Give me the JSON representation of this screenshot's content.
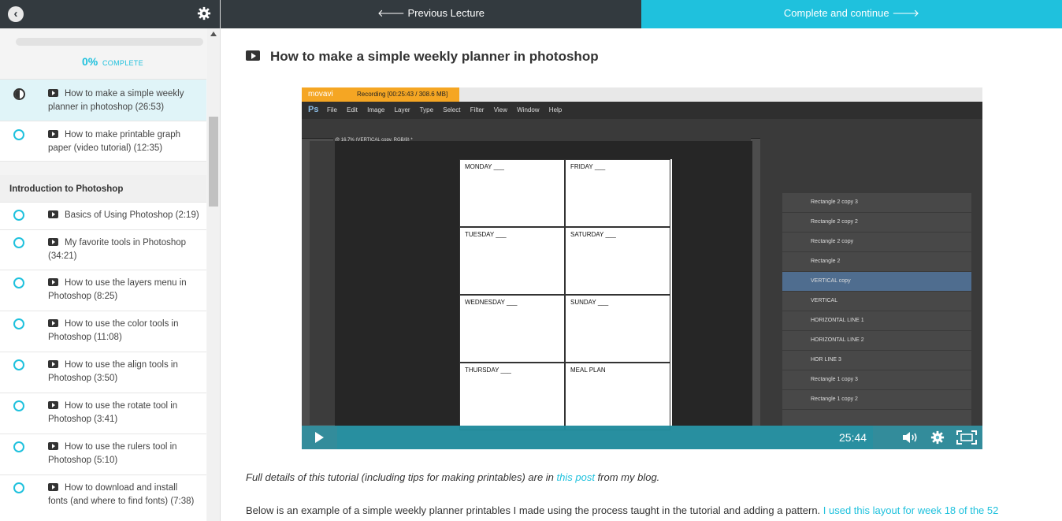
{
  "nav": {
    "prev_label": "🠔 Previous Lecture",
    "prev_text": "Previous Lecture",
    "next_text": "Complete and continue"
  },
  "progress": {
    "percent": "0%",
    "label": "COMPLETE",
    "fraction": 0
  },
  "lectures": [
    {
      "title": "How to make a simple weekly planner in photoshop (26:53)",
      "status": "in-progress",
      "active": true
    },
    {
      "title": "How to make printable graph paper (video tutorial) (12:35)",
      "status": "not-started"
    }
  ],
  "section": {
    "title": "Introduction to Photoshop",
    "lectures": [
      "Basics of Using Photoshop (2:19)",
      "My favorite tools in Photoshop (34:21)",
      "How to use the layers menu in Photoshop (8:25)",
      "How to use the color tools in Photoshop (11:08)",
      "How to use the align tools in Photoshop (3:50)",
      "How to use the rotate tool in Photoshop (3:41)",
      "How to use the rulers tool in Photoshop (5:10)",
      "How to download and install fonts (and where to find fonts) (7:38)"
    ]
  },
  "main": {
    "title": "How to make a simple weekly planner in photoshop",
    "desc1_pre": "Full details of this tutorial (including tips for making printables) are in ",
    "desc1_link": "this post",
    "desc1_post": " from my blog.",
    "desc2_pre": "Below is an example of a simple weekly planner printables I made using the process taught in the tutorial and adding a pattern. ",
    "desc2_link": "I used this layout for week 18 of the 52"
  },
  "video": {
    "time": "25:44",
    "recorder": "movavi",
    "recording_label": "Recording  [00:25:43 / 308.6 MB]",
    "ps_menu": [
      "File",
      "Edit",
      "Image",
      "Layer",
      "Type",
      "Select",
      "Filter",
      "View",
      "Window",
      "Help"
    ],
    "doc_tab": "@ 16.7% (VERTICAL copy, RGB/8) *",
    "planner_cells": [
      "MONDAY ___",
      "FRIDAY ___",
      "TUESDAY ___",
      "SATURDAY ___",
      "WEDNESDAY ___",
      "SUNDAY ___",
      "THURSDAY ___",
      "MEAL PLAN"
    ],
    "layers": [
      "Rectangle 2 copy 3",
      "Rectangle 2 copy 2",
      "Rectangle 2 copy",
      "Rectangle 2",
      "VERTICAL copy",
      "VERTICAL",
      "HORIZONTAL LINE 1",
      "HORIZONTAL LINE 2",
      "HOR LINE 3",
      "Rectangle 1 copy 3",
      "Rectangle 1 copy 2"
    ]
  },
  "colors": {
    "accent": "#1fc1dd",
    "dark": "#333a3f"
  }
}
